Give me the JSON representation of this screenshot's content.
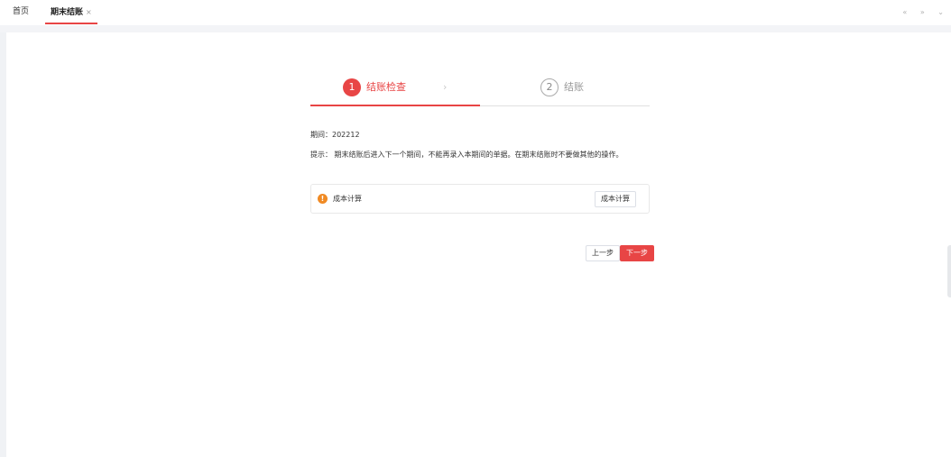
{
  "tabs": {
    "home_label": "首页",
    "active_label": "期末结账",
    "close_glyph": "×"
  },
  "tab_controls": {
    "first": "«",
    "last": "»",
    "menu": "⌄"
  },
  "steps": [
    {
      "number": "1",
      "label": "结账检查",
      "state": "active"
    },
    {
      "number": "2",
      "label": "结账",
      "state": "pending"
    }
  ],
  "step_separator": "›",
  "period_text": "期间：202212",
  "hint_text": "提示：  期末结账后进入下一个期间，不能再录入本期间的单据。在期末结账时不要做其他的操作。",
  "check_item": {
    "status_icon": "warning-icon",
    "status_glyph": "!",
    "title": "成本计算",
    "action_label": "成本计算"
  },
  "buttons": {
    "prev_label": "上一步",
    "next_label": "下一步"
  },
  "colors": {
    "accent": "#e84545",
    "warning": "#f08a24"
  }
}
